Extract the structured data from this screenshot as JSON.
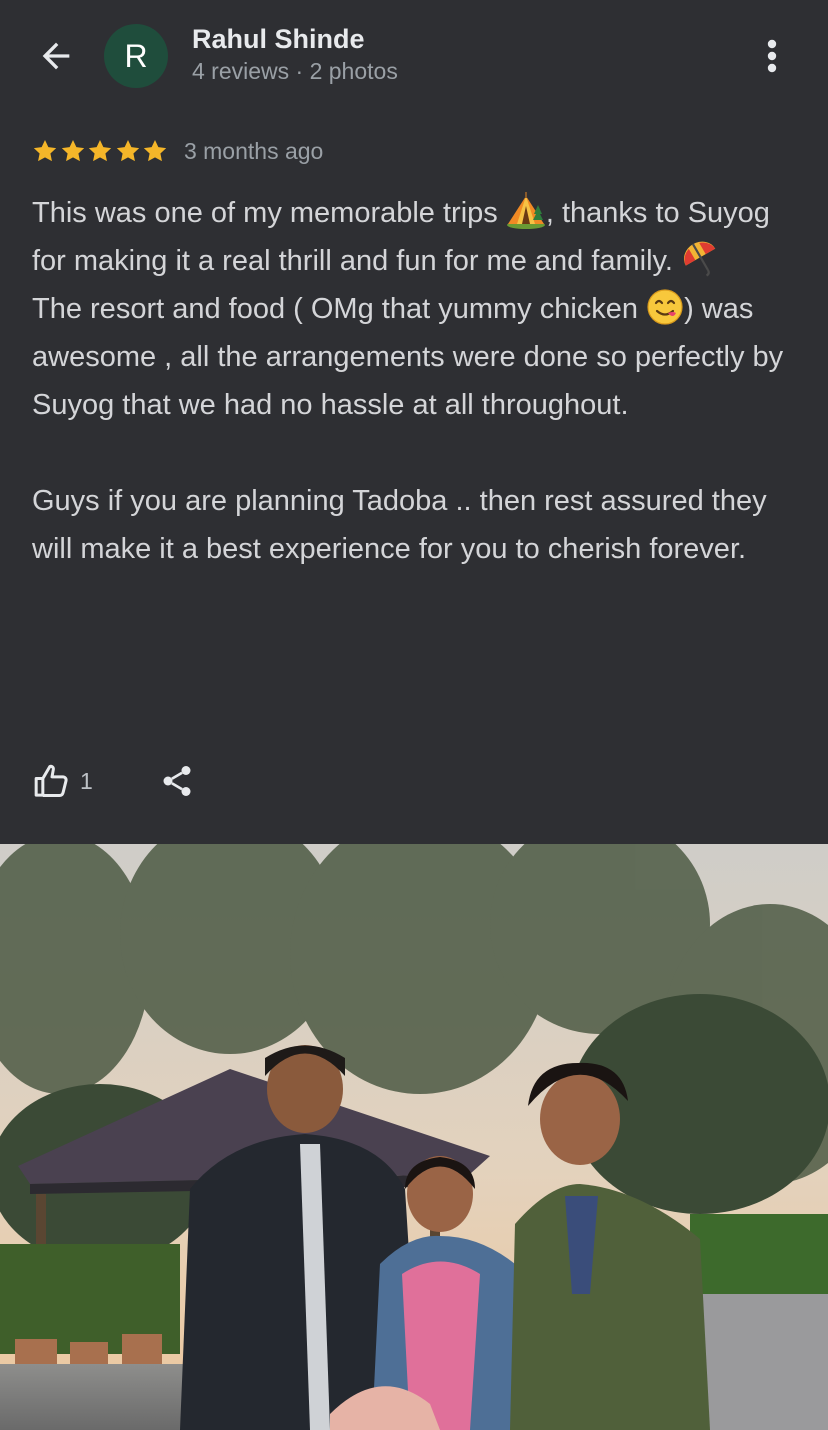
{
  "header": {
    "avatar_letter": "R",
    "user_name": "Rahul Shinde",
    "user_meta": "4 reviews · 2 photos",
    "icons": [
      "arrow-back-icon",
      "more-vertical-icon"
    ]
  },
  "review": {
    "rating": 5,
    "max_rating": 5,
    "time": "3 months ago",
    "paragraphs": {
      "p1": "This was one of my memorable trips",
      "p1b": ", thanks to Suyog for making it a real thrill and fun for me and family.",
      "p2": "The resort and food ( OMg that yummy chicken",
      "p2b": ") was awesome , all the arrangements were done so perfectly by Suyog that we had no hassle at all throughout.",
      "p3": "Guys if you are planning Tadoba .. then rest assured they will make it a best experience for you to cherish forever."
    },
    "emojis": [
      "tent-emoji",
      "umbrella-emoji",
      "yum-face-emoji"
    ]
  },
  "actions": {
    "like_count": "1",
    "icons": [
      "thumb-up-icon",
      "share-icon"
    ]
  },
  "colors": {
    "background": "#2e2f33",
    "avatar_bg": "#1f4d3c",
    "star": "#f5b629",
    "primary_text": "#e8eaed",
    "secondary_text": "#9aa0a6",
    "body_text": "#d4d5d8"
  }
}
